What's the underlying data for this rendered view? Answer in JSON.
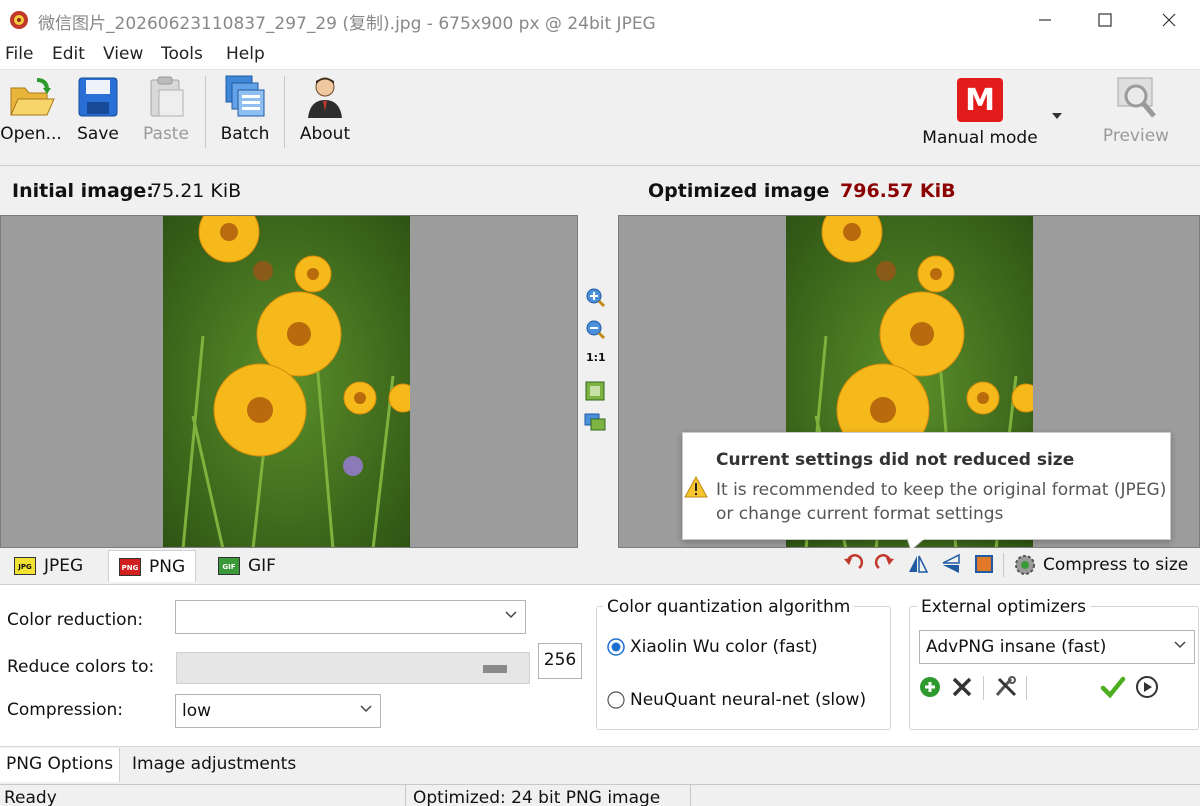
{
  "window": {
    "title": "微信图片_20260623110837_297_29 (复制).jpg - 675x900 px @ 24bit JPEG",
    "minimize": "—",
    "maximize": "☐",
    "close": "✕"
  },
  "menu": [
    "File",
    "Edit",
    "View",
    "Tools",
    "Help"
  ],
  "toolbar": {
    "open": "Open...",
    "save": "Save",
    "paste": "Paste",
    "batch": "Batch",
    "about": "About",
    "mode_badge": "M",
    "mode": "Manual mode",
    "preview": "Preview"
  },
  "initial": {
    "label": "Initial image:",
    "size": "75.21 KiB"
  },
  "optimized": {
    "label": "Optimized image",
    "size": "796.57 KiB"
  },
  "zoom_tools": {
    "one_to_one": "1:1"
  },
  "tooltip": {
    "title": "Current settings did not reduced size",
    "line1": "It is recommended to keep the original format (JPEG)",
    "line2": "or change current format settings"
  },
  "format_tabs": [
    {
      "badge": "JPG",
      "label": "JPEG",
      "color": "#f2e233"
    },
    {
      "badge": "PNG",
      "label": "PNG",
      "color": "#d21f1f"
    },
    {
      "badge": "GIF",
      "label": "GIF",
      "color": "#3a9a3a"
    }
  ],
  "compress_to_size": "Compress to size",
  "png_settings": {
    "color_reduction_label": "Color reduction:",
    "color_reduction_value": "",
    "reduce_colors_label": "Reduce colors to:",
    "reduce_colors_value": "256",
    "compression_label": "Compression:",
    "compression_value": "low"
  },
  "quantization": {
    "title": "Color quantization algorithm",
    "options": [
      "Xiaolin Wu color (fast)",
      "NeuQuant neural-net (slow)"
    ],
    "selected": 0
  },
  "external": {
    "title": "External optimizers",
    "value": "AdvPNG insane (fast)"
  },
  "bottom_tabs": [
    "PNG Options",
    "Image adjustments"
  ],
  "status": {
    "left": "Ready",
    "right": "Optimized: 24 bit PNG image"
  },
  "colors": {
    "accent_red": "#8b0000",
    "manual_badge": "#e31b1b",
    "radio_blue": "#1a6fd0",
    "add_green": "#2e9a2e",
    "check_green": "#4caf20"
  }
}
